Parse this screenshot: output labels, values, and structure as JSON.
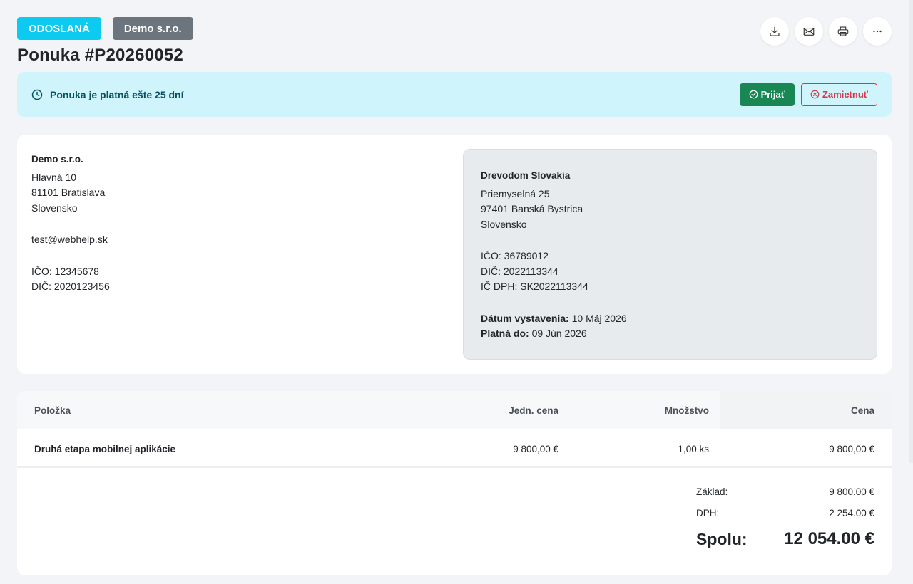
{
  "header": {
    "status_badge": "ODOSLANÁ",
    "company_badge": "Demo s.r.o.",
    "title": "Ponuka #P20260052",
    "actions": [
      {
        "icon": "download-icon"
      },
      {
        "icon": "mail-icon"
      },
      {
        "icon": "printer-icon"
      },
      {
        "icon": "more-icon"
      }
    ]
  },
  "alert": {
    "icon": "clock-icon",
    "text": "Ponuka je platná ešte 25 dní",
    "accept_label": "Prijať",
    "reject_label": "Zamietnuť"
  },
  "supplier": {
    "name": "Demo s.r.o.",
    "street": "Hlavná 10",
    "city": "81101 Bratislava",
    "country": "Slovensko",
    "email": "test@webhelp.sk",
    "ico": "IČO: 12345678",
    "dic": "DIČ: 2020123456"
  },
  "customer": {
    "name": "Drevodom Slovakia",
    "street": "Priemyselná 25",
    "city": "97401 Banská Bystrica",
    "country": "Slovensko",
    "ico": "IČO: 36789012",
    "dic": "DIČ: 2022113344",
    "icdph": "IČ DPH: SK2022113344",
    "issue_label": "Dátum vystavenia:",
    "issue_date": "10 Máj 2026",
    "valid_label": "Platná do:",
    "valid_date": "09 Jún 2026"
  },
  "table": {
    "headers": {
      "item": "Položka",
      "unit_price": "Jedn. cena",
      "quantity": "Množstvo",
      "total": "Cena"
    },
    "rows": [
      {
        "item": "Druhá etapa mobilnej aplikácie",
        "unit_price": "9 800,00 €",
        "quantity": "1,00 ks",
        "total": "9 800,00 €"
      }
    ]
  },
  "totals": {
    "base_label": "Základ:",
    "base_value": "9 800.00 €",
    "vat_label": "DPH:",
    "vat_value": "2 254.00 €",
    "grand_label": "Spolu:",
    "grand_value": "12 054.00 €"
  },
  "colors": {
    "status": "#0dcaf0",
    "company": "#6c757d",
    "alert_bg": "#cff4fc",
    "alert_text": "#055160",
    "accept": "#198754",
    "reject": "#dc3545"
  }
}
